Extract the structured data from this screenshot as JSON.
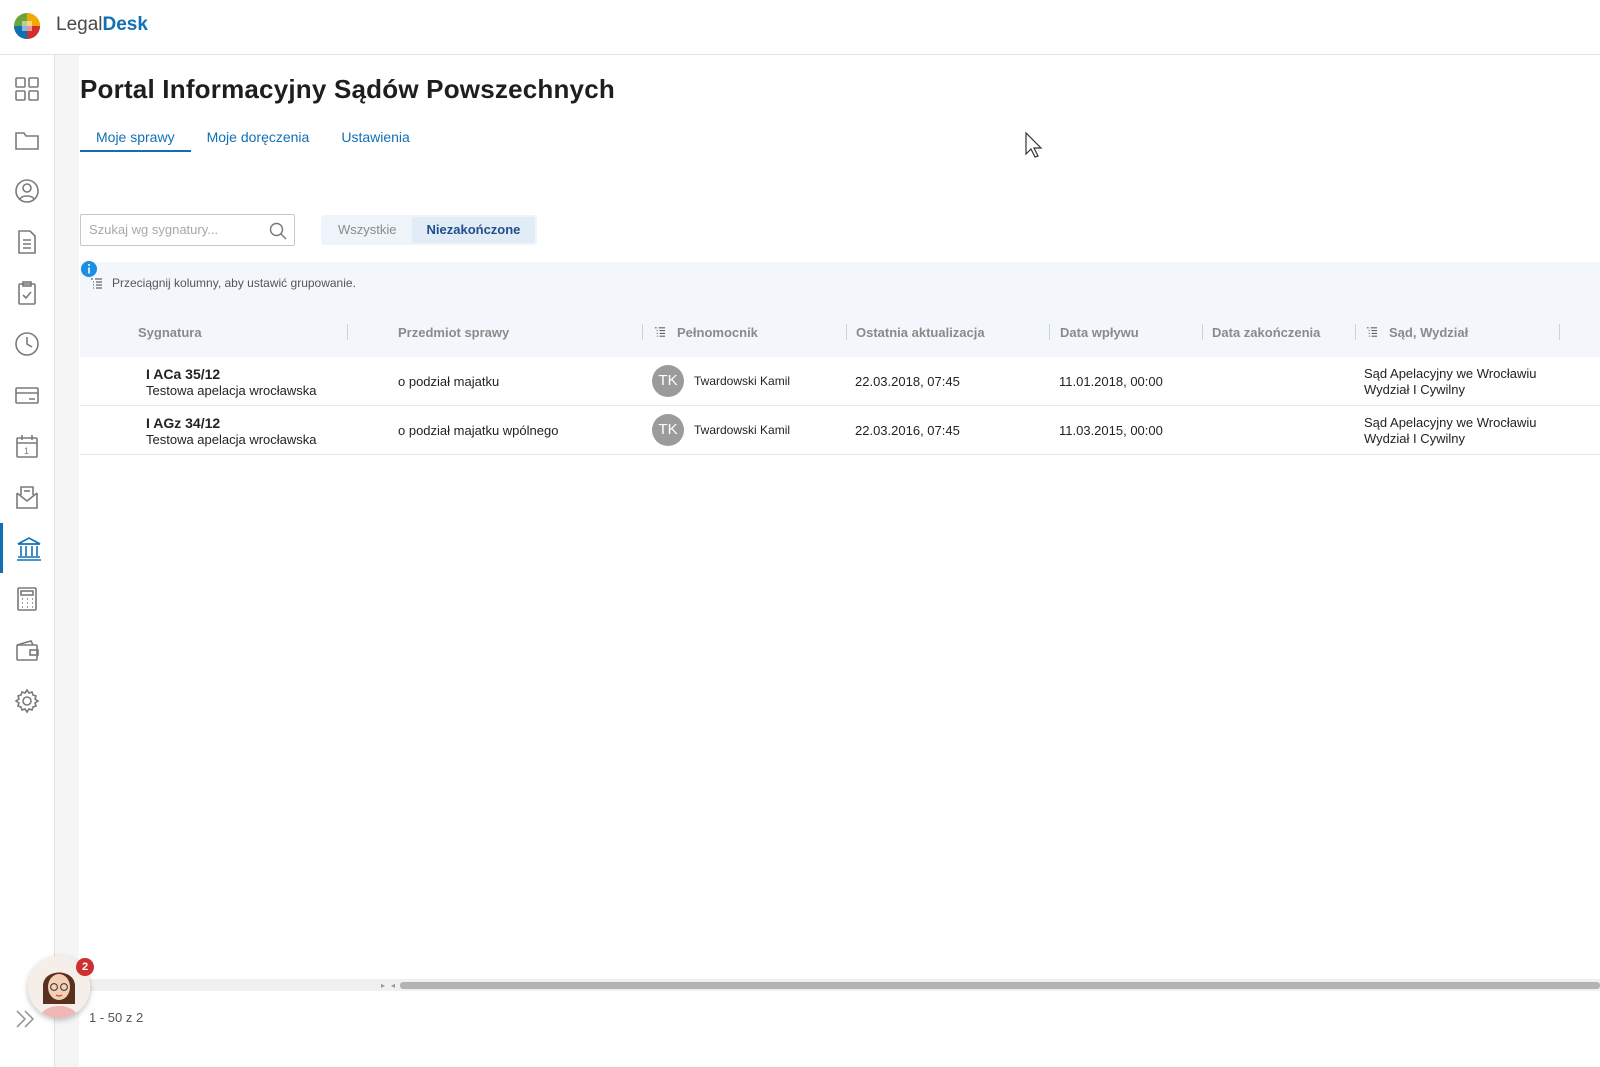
{
  "brand": {
    "light": "Legal",
    "bold": "Desk"
  },
  "sidebar": {
    "items": [
      {
        "name": "dashboard",
        "icon": "grid-icon"
      },
      {
        "name": "cases",
        "icon": "folder-icon"
      },
      {
        "name": "contacts",
        "icon": "user-circle-icon"
      },
      {
        "name": "documents",
        "icon": "document-icon"
      },
      {
        "name": "tasks",
        "icon": "clipboard-check-icon"
      },
      {
        "name": "time",
        "icon": "clock-icon"
      },
      {
        "name": "billing",
        "icon": "card-icon"
      },
      {
        "name": "calendar",
        "icon": "calendar-icon",
        "text": "1"
      },
      {
        "name": "mail",
        "icon": "mail-icon"
      },
      {
        "name": "courts",
        "icon": "courthouse-icon",
        "active": true
      },
      {
        "name": "calculator",
        "icon": "calculator-icon"
      },
      {
        "name": "wallet",
        "icon": "wallet-icon"
      },
      {
        "name": "settings",
        "icon": "gear-icon"
      }
    ]
  },
  "page": {
    "title": "Portal Informacyjny Sądów Powszechnych"
  },
  "tabs": [
    "Moje sprawy",
    "Moje doręczenia",
    "Ustawienia"
  ],
  "search": {
    "placeholder": "Szukaj wg sygnatury..."
  },
  "filter": {
    "all": "Wszystkie",
    "open": "Niezakończone",
    "selected": "Niezakończone"
  },
  "grouping": {
    "hint": "Przeciągnij kolumny, aby ustawić grupowanie."
  },
  "table": {
    "columns": [
      "Sygnatura",
      "Przedmiot sprawy",
      "Pełnomocnik",
      "Ostatnia aktualizacja",
      "Data wpływu",
      "Data zakończenia",
      "Sąd, Wydział"
    ],
    "rows": [
      {
        "signature": "I ACa 35/12",
        "name": "Testowa apelacja wrocławska",
        "subject": "o podział majatku",
        "initials": "TK",
        "attorney": "Twardowski Kamil",
        "updated": "22.03.2018, 07:45",
        "received": "11.01.2018, 00:00",
        "closed": "",
        "court": "Sąd Apelacyjny we Wrocławiu",
        "division": "Wydział I Cywilny"
      },
      {
        "signature": "I AGz 34/12",
        "name": "Testowa apelacja wrocławska",
        "subject": "o podział majatku wpólnego",
        "initials": "TK",
        "attorney": "Twardowski Kamil",
        "updated": "22.03.2016, 07:45",
        "received": "11.03.2015, 00:00",
        "closed": "",
        "court": "Sąd Apelacyjny we Wrocławiu",
        "division": "Wydział I Cywilny"
      }
    ]
  },
  "pager": {
    "text": "1 - 50 z 2"
  },
  "assistant": {
    "badge": "2"
  },
  "colors": {
    "accent": "#1170b5",
    "header_bg": "#f3f7fb"
  }
}
